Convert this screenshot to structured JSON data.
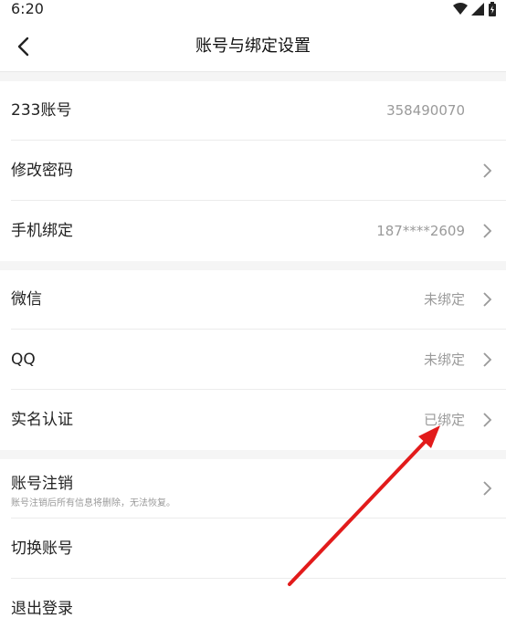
{
  "status": {
    "time": "6:20"
  },
  "header": {
    "title": "账号与绑定设置"
  },
  "rows": {
    "account": {
      "label": "233账号",
      "value": "358490070"
    },
    "password": {
      "label": "修改密码"
    },
    "phone": {
      "label": "手机绑定",
      "value": "187****2609"
    },
    "wechat": {
      "label": "微信",
      "value": "未绑定"
    },
    "qq": {
      "label": "QQ",
      "value": "未绑定"
    },
    "realname": {
      "label": "实名认证",
      "value": "已绑定"
    },
    "cancel": {
      "label": "账号注销",
      "sub": "账号注销后所有信息将删除，无法恢复。"
    },
    "switch": {
      "label": "切换账号"
    },
    "logout": {
      "label": "退出登录"
    }
  },
  "colors": {
    "annotation_arrow": "#e21b1b",
    "section_gap": "#f5f5f5"
  }
}
